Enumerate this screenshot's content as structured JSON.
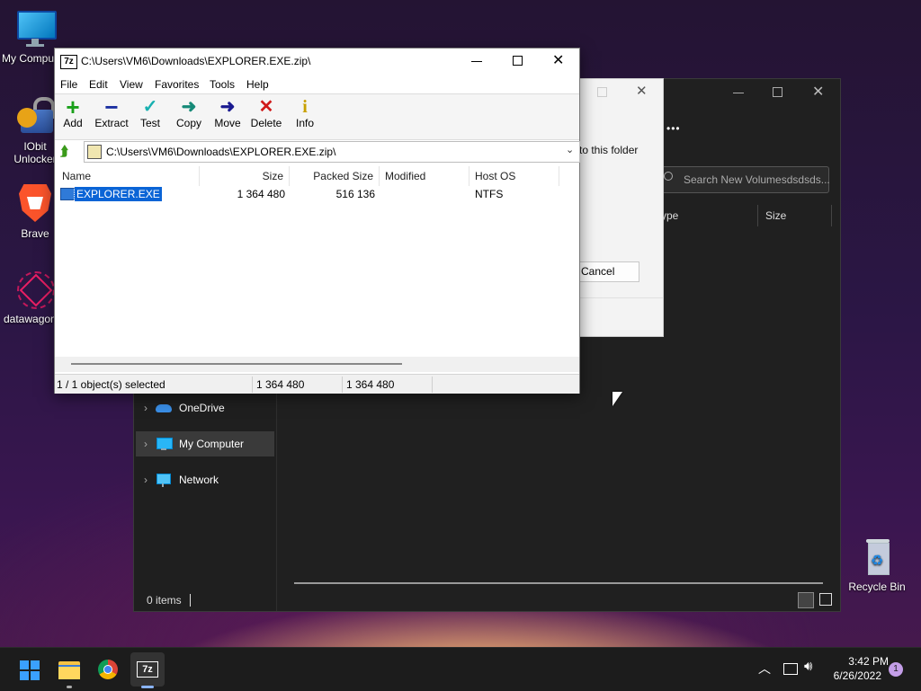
{
  "desktop": {
    "icons": [
      {
        "label": "My Compu",
        "icon": "monitor-icon"
      },
      {
        "label": "IObit Unlocker",
        "icon": "iobit-unlocker-icon"
      },
      {
        "label": "Brave",
        "icon": "brave-icon"
      },
      {
        "label": "datawagon",
        "icon": "datawagon-icon"
      },
      {
        "label": "Recycle Bin",
        "icon": "recycle-bin-icon"
      }
    ]
  },
  "bg_explorer": {
    "search_placeholder": "Search New Volumesdsdsds...",
    "col_type": "ype",
    "col_size": "Size",
    "more": "•••",
    "nav": [
      {
        "label": "OneDrive",
        "icon": "onedrive-icon"
      },
      {
        "label": "My Computer",
        "icon": "computer-icon"
      },
      {
        "label": "Network",
        "icon": "network-icon"
      }
    ],
    "status": "0 items"
  },
  "dialog": {
    "text": "to this folder",
    "cancel": "Cancel"
  },
  "sevenzip": {
    "title": "C:\\Users\\VM6\\Downloads\\EXPLORER.EXE.zip\\",
    "app_badge": "7z",
    "menu": [
      "File",
      "Edit",
      "View",
      "Favorites",
      "Tools",
      "Help"
    ],
    "toolbar": [
      {
        "label": "Add",
        "icon": "add-icon",
        "color": "#1aa01a"
      },
      {
        "label": "Extract",
        "icon": "extract-icon",
        "color": "#1a2fa0"
      },
      {
        "label": "Test",
        "icon": "test-icon",
        "color": "#18b0b0"
      },
      {
        "label": "Copy",
        "icon": "copy-icon",
        "color": "#168a78"
      },
      {
        "label": "Move",
        "icon": "move-icon",
        "color": "#1a1a90"
      },
      {
        "label": "Delete",
        "icon": "delete-icon",
        "color": "#d01a1a"
      },
      {
        "label": "Info",
        "icon": "info-icon",
        "color": "#c8a000"
      }
    ],
    "address": "C:\\Users\\VM6\\Downloads\\EXPLORER.EXE.zip\\",
    "columns": [
      "Name",
      "Size",
      "Packed Size",
      "Modified",
      "Host OS"
    ],
    "rows": [
      {
        "name": "EXPLORER.EXE",
        "size": "1 364 480",
        "packed": "516 136",
        "modified": "",
        "host": "NTFS"
      }
    ],
    "status": [
      "1 / 1 object(s) selected",
      "1 364 480",
      "1 364 480"
    ]
  },
  "taskbar": {
    "time": "3:42 PM",
    "date": "6/26/2022",
    "notification_count": "1",
    "apps": [
      "start-icon",
      "file-explorer-icon",
      "chrome-icon",
      "sevenzip-icon"
    ]
  }
}
